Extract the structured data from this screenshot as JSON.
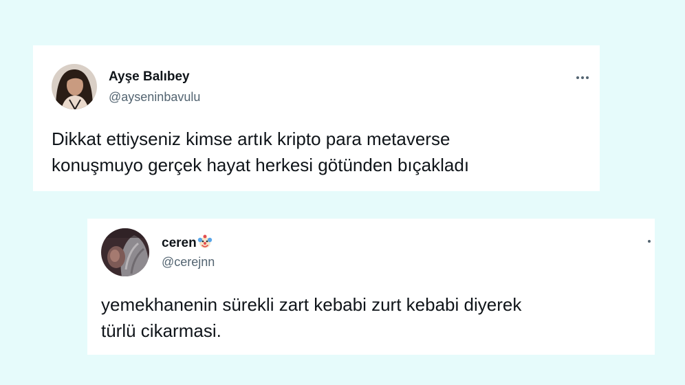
{
  "tweets": [
    {
      "display_name": "Ayşe Balıbey",
      "handle": "@ayseninbavulu",
      "avatar_icon": "profile-photo",
      "more_icon": "more-options-icon",
      "text_lines": [
        "Dikkat ettiyseniz kimse artık kripto para metaverse",
        "konuşmuyo gerçek hayat herkesi götünden bıçakladı"
      ]
    },
    {
      "display_name": "ceren",
      "name_emoji": "clown-face-emoji",
      "handle": "@cerejnn",
      "avatar_icon": "profile-photo",
      "more_icon": "more-options-icon",
      "text_lines": [
        "yemekhanenin sürekli zart kebabi zurt kebabi diyerek",
        "türlü cikarmasi."
      ]
    }
  ],
  "colors": {
    "background": "#e6fbfb",
    "card": "#ffffff",
    "text": "#0f1419",
    "secondary_text": "#536471"
  }
}
